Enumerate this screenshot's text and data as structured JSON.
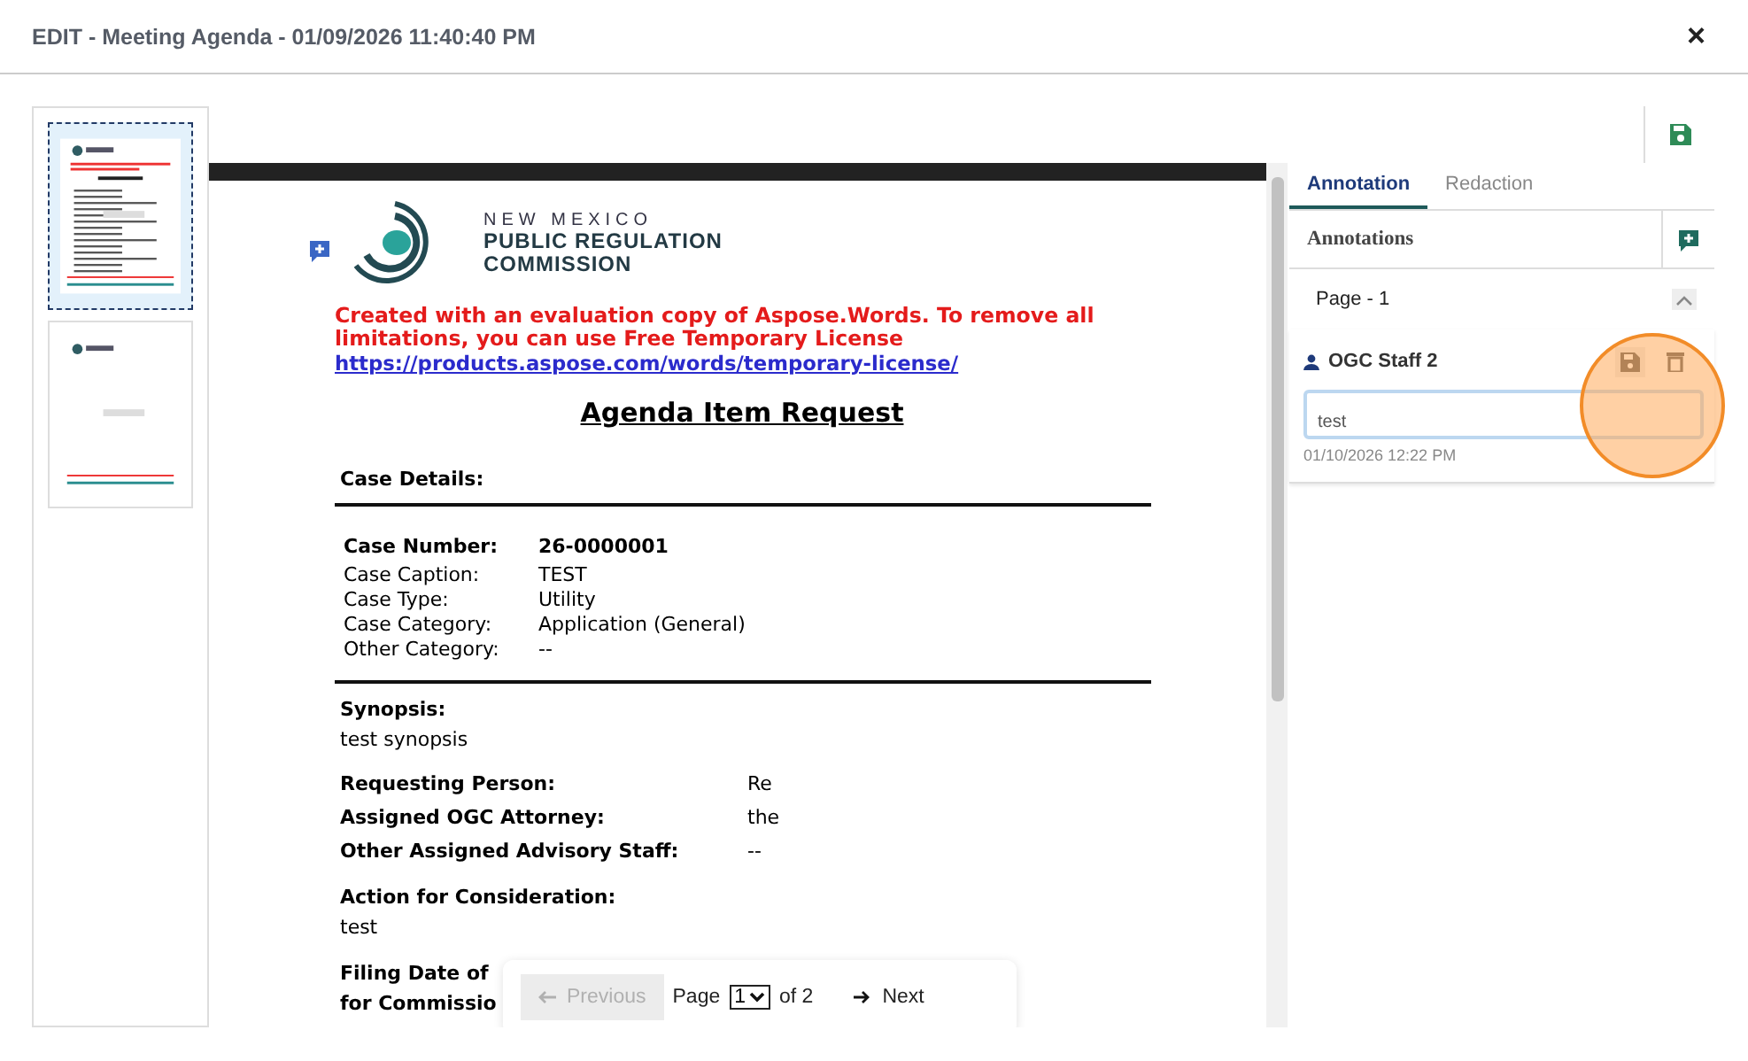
{
  "window": {
    "title": "EDIT - Meeting Agenda - 01/09/2026 11:40:40 PM",
    "close": "×"
  },
  "thumbnails": [
    {
      "selected": true
    },
    {
      "selected": false
    }
  ],
  "document": {
    "logo": {
      "line1": "NEW MEXICO",
      "line2": "PUBLIC REGULATION",
      "line3": "COMMISSION"
    },
    "notice": "Created with an evaluation copy of Aspose.Words. To remove all limitations, you can use Free Temporary License",
    "notice_link": "https://products.aspose.com/words/temporary-license/",
    "heading": "Agenda Item Request",
    "section": "Case Details:",
    "case_fields": [
      {
        "label": "Case Number:",
        "value": "26-0000001",
        "bold": true
      },
      {
        "label": "Case Caption:",
        "value": "TEST",
        "bold": false
      },
      {
        "label": "Case Type:",
        "value": "Utility",
        "bold": false
      },
      {
        "label": "Case Category:",
        "value": "Application (General)",
        "bold": false
      },
      {
        "label": "Other Category:",
        "value": "--",
        "bold": false
      }
    ],
    "blocks": [
      {
        "kind": "heading",
        "text": "Synopsis:"
      },
      {
        "kind": "text",
        "text": "test synopsis"
      },
      {
        "kind": "pair",
        "label": "Requesting Person:",
        "value": "Re"
      },
      {
        "kind": "pair",
        "label": "Assigned OGC Attorney:",
        "value": "the"
      },
      {
        "kind": "pair",
        "label": "Other Assigned Advisory Staff:",
        "value": "--"
      },
      {
        "kind": "heading",
        "text": "Action for Consideration:"
      },
      {
        "kind": "text",
        "text": "test"
      },
      {
        "kind": "heading",
        "text": "Filing Date of"
      },
      {
        "kind": "heading",
        "text": "for Commissio"
      }
    ]
  },
  "pager": {
    "previous": "Previous",
    "previous_disabled": true,
    "page_label": "Page",
    "page": "1",
    "of": "of 2",
    "next": "Next"
  },
  "panel": {
    "tabs": [
      {
        "label": "Annotation",
        "selected": true
      },
      {
        "label": "Redaction",
        "selected": false
      }
    ],
    "title": "Annotations",
    "group": {
      "label": "Page - 1",
      "expanded": true
    },
    "comments": [
      {
        "author": "OGC Staff 2",
        "text": "test",
        "date": "01/10/2026 12:22 PM"
      }
    ]
  }
}
